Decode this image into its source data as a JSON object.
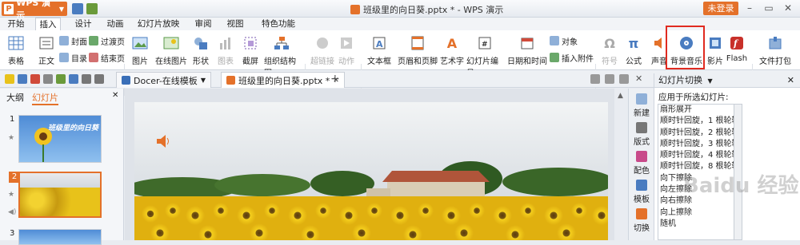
{
  "app": {
    "name": "WPS 演示",
    "logo": "P",
    "title": "班级里的向日葵.pptx * - WPS 演示",
    "login": "未登录"
  },
  "menu_tabs": [
    "开始",
    "插入",
    "设计",
    "动画",
    "幻灯片放映",
    "审阅",
    "视图",
    "特色功能"
  ],
  "active_tab": "插入",
  "ribbon": {
    "table": "表格",
    "text_group": {
      "body": "正文",
      "cover": "封面",
      "toc": "目录",
      "transition": "过渡页",
      "end": "结束页"
    },
    "picture": "图片",
    "online_picture": "在线图片",
    "shape": "形状",
    "chart": "图表",
    "screenshot": "截屏",
    "org_chart": "组织结构图",
    "hyperlink": "超链接",
    "action": "动作",
    "textbox": "文本框",
    "header_footer": "页眉和页脚",
    "wordart": "艺术字",
    "slide_number": "幻灯片编号",
    "date_time": "日期和时间",
    "object": "对象",
    "attachment": "插入附件",
    "symbol": "符号",
    "formula": "公式",
    "sound": "声音",
    "bg_music": "背景音乐",
    "movie": "影片",
    "flash": "Flash",
    "package": "文件打包"
  },
  "doc_tabs": [
    {
      "label": "Docer-在线模板"
    },
    {
      "label": "班级里的向日葵.pptx *"
    }
  ],
  "left_panel": {
    "tabs": [
      "大纲",
      "幻灯片"
    ],
    "slides": [
      {
        "num": "1",
        "title": "班级里的向日葵"
      },
      {
        "num": "2"
      },
      {
        "num": "3"
      }
    ]
  },
  "side_tools": [
    "新建",
    "版式",
    "配色",
    "模板",
    "切换"
  ],
  "right_panel": {
    "title": "幻灯片切换",
    "apply_label": "应用于所选幻灯片:",
    "effects": [
      "扇形展开",
      "顺时针回旋，1 根轮辐",
      "顺时针回旋，2 根轮辐",
      "顺时针回旋，3 根轮辐",
      "顺时针回旋，4 根轮辐",
      "顺时针回旋，8 根轮辐",
      "向下擦除",
      "向左擦除",
      "向右擦除",
      "向上擦除",
      "随机"
    ]
  },
  "watermark": "Baidu 经验",
  "colors": {
    "accent": "#e4712a",
    "highlight": "#e02a20",
    "sky": "#6aa2d8",
    "sunflower": "#e8c21a"
  }
}
